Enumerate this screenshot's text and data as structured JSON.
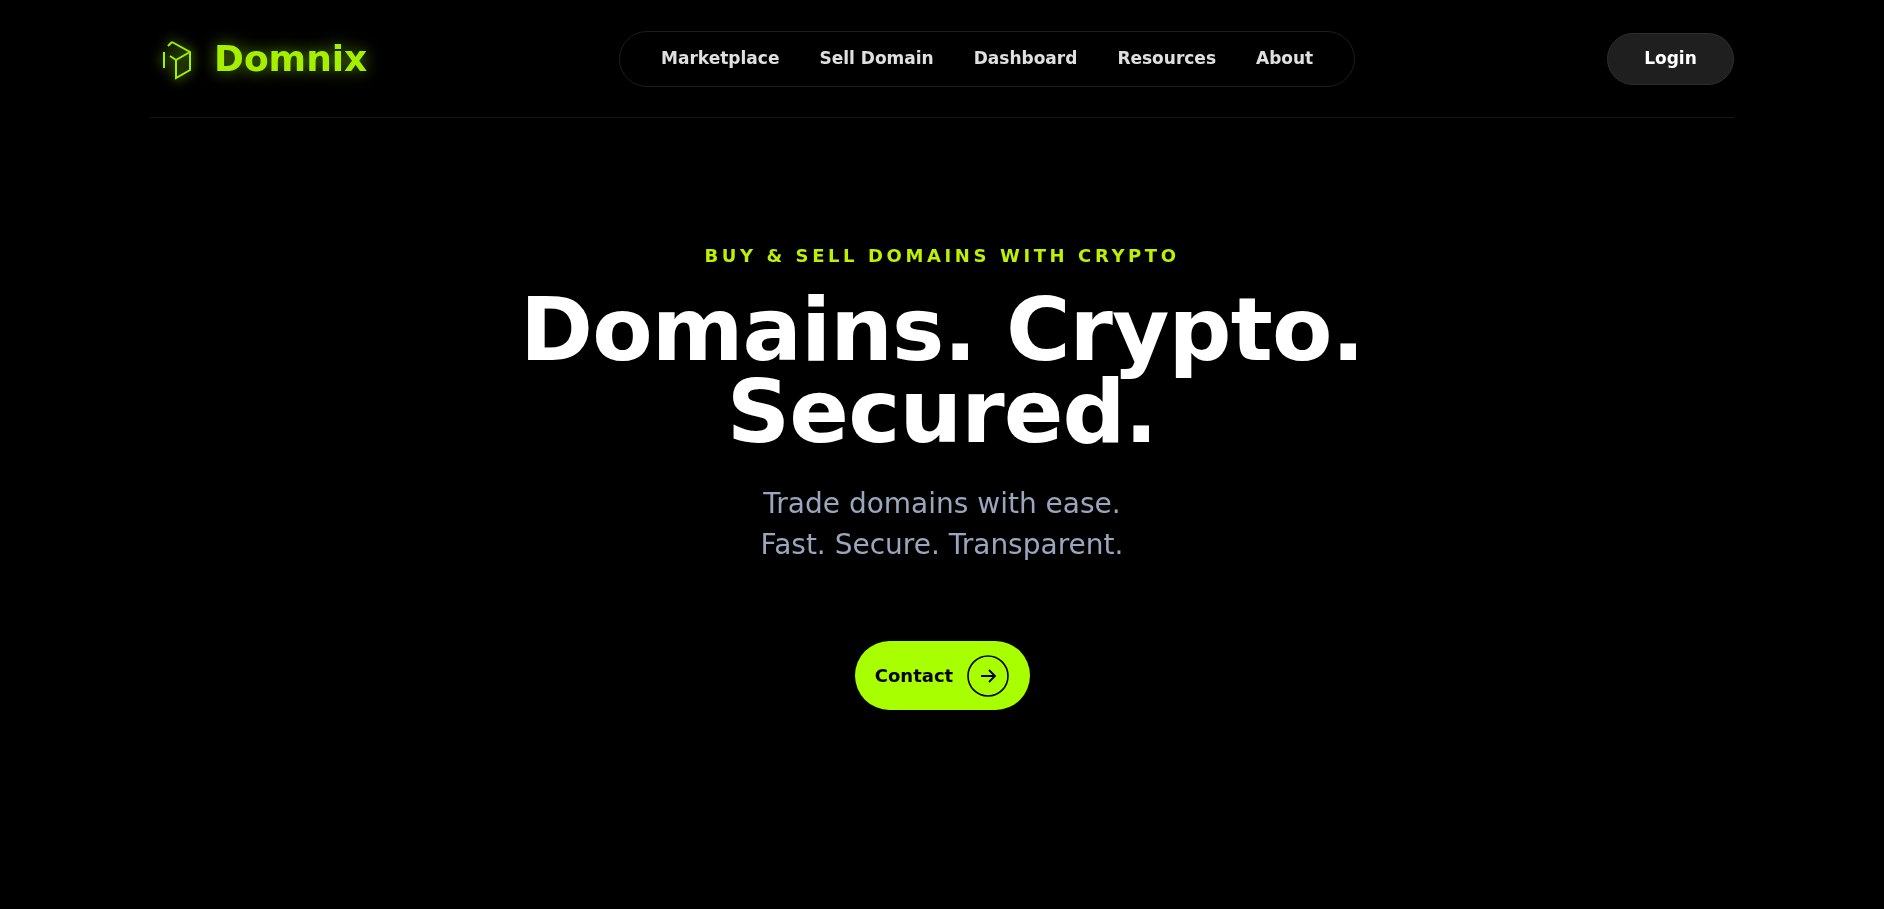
{
  "logo": {
    "text": "Domnix"
  },
  "nav": [
    {
      "label": "Marketplace"
    },
    {
      "label": "Sell Domain"
    },
    {
      "label": "Dashboard"
    },
    {
      "label": "Resources"
    },
    {
      "label": "About"
    }
  ],
  "login": "Login",
  "hero": {
    "eyebrow": "BUY & SELL DOMAINS WITH CRYPTO",
    "headline": [
      "Domains. Crypto.",
      "Secured."
    ],
    "subtitle": [
      "Trade domains with ease.",
      "Fast. Secure. Transparent."
    ],
    "cta": "Contact"
  }
}
